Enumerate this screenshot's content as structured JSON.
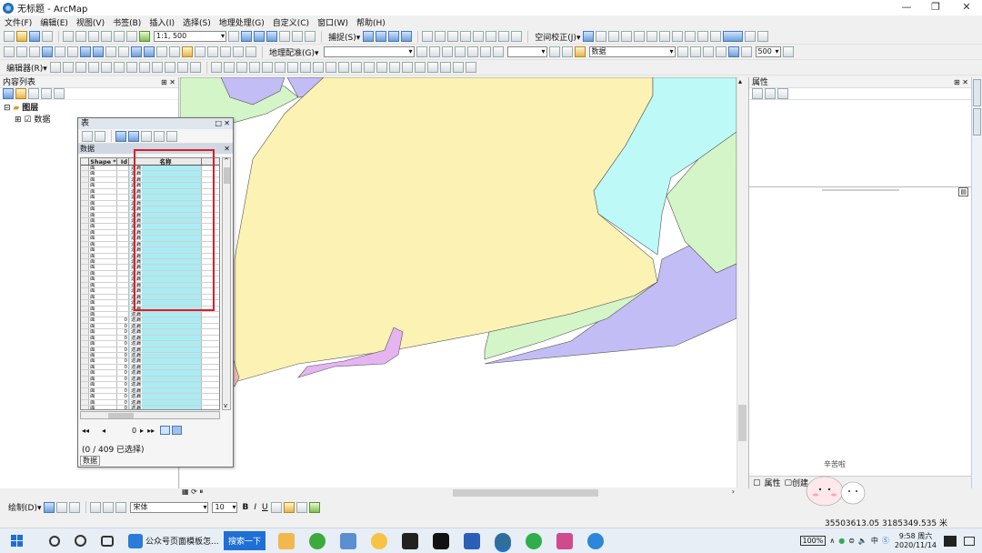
{
  "window": {
    "title": "无标题 - ArcMap",
    "minimize": "—",
    "restore": "❐",
    "close": "✕"
  },
  "menu": [
    "文件(F)",
    "编辑(E)",
    "视图(V)",
    "书签(B)",
    "插入(I)",
    "选择(S)",
    "地理处理(G)",
    "自定义(C)",
    "窗口(W)",
    "帮助(H)"
  ],
  "toolbar1": {
    "scale": "1:1, 500",
    "snapping_label": "捕捉(S)▾",
    "spatial_adjust_label": "空间校正(J)▾"
  },
  "toolbar2": {
    "georef_label": "地理配准(G)▾",
    "layer_combo": "数据",
    "zoom_value": "500"
  },
  "toolbar3": {
    "editor_label": "编辑器(R)▾"
  },
  "toc": {
    "title": "内容列表",
    "root": "图层",
    "layer": "数据"
  },
  "table_window": {
    "title": "表",
    "tab_name": "数据",
    "columns": [
      "Shape *",
      "Id",
      "名称"
    ],
    "rows": [
      [
        "面",
        "",
        "遗漏"
      ],
      [
        "面",
        "",
        "遗漏"
      ],
      [
        "面",
        "",
        "遗漏"
      ],
      [
        "面",
        "",
        "遗漏"
      ],
      [
        "面",
        "",
        "遗漏"
      ],
      [
        "面",
        "",
        "遗漏"
      ],
      [
        "面",
        "",
        "遗漏"
      ],
      [
        "面",
        "",
        "遗漏"
      ],
      [
        "面",
        "",
        "遗漏"
      ],
      [
        "面",
        "",
        "遗漏"
      ],
      [
        "面",
        "",
        "遗漏"
      ],
      [
        "面",
        "",
        "遗漏"
      ],
      [
        "面",
        "",
        "遗漏"
      ],
      [
        "面",
        "",
        "遗漏"
      ],
      [
        "面",
        "",
        "遗漏"
      ],
      [
        "面",
        "",
        "遗漏"
      ],
      [
        "面",
        "",
        "遗漏"
      ],
      [
        "面",
        "",
        "遗漏"
      ],
      [
        "面",
        "",
        "遗漏"
      ],
      [
        "面",
        "",
        "遗漏"
      ],
      [
        "面",
        "",
        "遗漏"
      ],
      [
        "面",
        "",
        "遗漏"
      ],
      [
        "面",
        "",
        "遗漏"
      ],
      [
        "面",
        "",
        "遗漏"
      ],
      [
        "面",
        "",
        "遗漏"
      ],
      [
        "面",
        "",
        "遗漏"
      ],
      [
        "面",
        "0",
        "遗漏"
      ],
      [
        "面",
        "0",
        "遗漏"
      ],
      [
        "面",
        "0",
        "遗漏"
      ],
      [
        "面",
        "0",
        "遗漏"
      ],
      [
        "面",
        "0",
        "遗漏"
      ],
      [
        "面",
        "0",
        "遗漏"
      ],
      [
        "面",
        "0",
        "遗漏"
      ],
      [
        "面",
        "0",
        "遗漏"
      ],
      [
        "面",
        "0",
        "遗漏"
      ],
      [
        "面",
        "0",
        "遗漏"
      ],
      [
        "面",
        "0",
        "遗漏"
      ],
      [
        "面",
        "0",
        "遗漏"
      ],
      [
        "面",
        "0",
        "遗漏"
      ],
      [
        "面",
        "0",
        "遗漏"
      ],
      [
        "面",
        "0",
        "遗漏"
      ],
      [
        "面",
        "0",
        "遗漏"
      ]
    ],
    "record_value": "0",
    "selection_info": "(0 / 409 已选择)",
    "footer_tab": "数据"
  },
  "properties": {
    "title": "属性"
  },
  "map_colors": {
    "yellow": "#fbf2b4",
    "cyan": "#bdf9f7",
    "lavender": "#c3bdf6",
    "green": "#d3f5c8",
    "pink": "#f2bdba",
    "magenta": "#e6b4f1"
  },
  "bottom_tabs": {
    "props": "属性",
    "create": "创建"
  },
  "drawbar": {
    "label": "绘制(D)▾",
    "font": "宋体",
    "size": "10"
  },
  "status": {
    "coords": "35503613.05  3185349.535 米"
  },
  "taskbar": {
    "search_btn": "搜索一下",
    "browser_tab": "公众号页面模板怎...",
    "battery": "100%",
    "time": "9:58 周六",
    "date": "2020/11/14",
    "ime": "中"
  },
  "sticker": {
    "text": "辛苦啦"
  }
}
